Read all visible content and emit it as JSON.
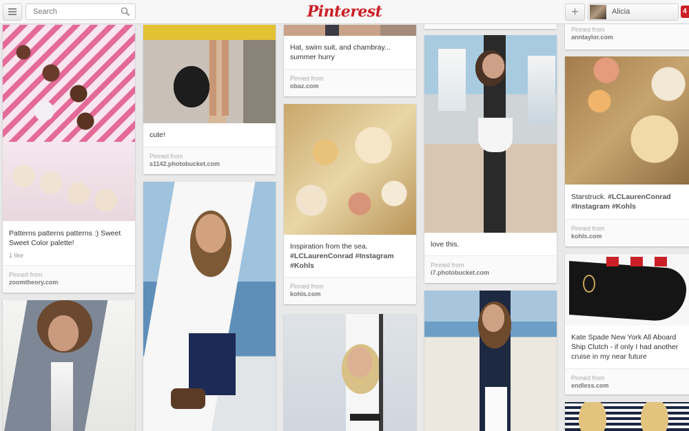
{
  "header": {
    "search_placeholder": "Search",
    "logo_text": "Pinterest",
    "add_label": "+",
    "user_name": "Alicia",
    "notification_count": "4"
  },
  "pins": {
    "patterns": {
      "description": "Patterns patterns patterns :) Sweet Sweet Color palette!",
      "likes": "1 like",
      "pinned_from": "Pinned from",
      "source": "zoomtheory.com"
    },
    "cute": {
      "description": "cute!",
      "pinned_from": "Pinned from",
      "source": "s1142.photobucket.com"
    },
    "hat": {
      "description": "Hat, swim suit, and chambray... summer hurry",
      "pinned_from": "Pinned from",
      "source": "obaz.com"
    },
    "sea": {
      "description_main": "Inspiration from the sea.",
      "description_tags": "#LCLaurenConrad #Instagram #Kohls",
      "pinned_from": "Pinned from",
      "source": "kohls.com"
    },
    "lovethis": {
      "description": "love this.",
      "pinned_from": "Pinned from",
      "source": "i7.photobucket.com"
    },
    "ann": {
      "pinned_from": "Pinned from",
      "source": "anntaylor.com"
    },
    "starstruck": {
      "description_main": "Starstruck.",
      "description_tags": "#LCLaurenConrad #Instagram #Kohls",
      "pinned_from": "Pinned from",
      "source": "kohls.com"
    },
    "clutch": {
      "description": "Kate Spade New York All Aboard Ship Clutch - if only I had another cruise in my near future",
      "pinned_from": "Pinned from",
      "source": "endless.com"
    }
  },
  "colors": {
    "brand": "#cb2027",
    "background": "#e9e9e9"
  },
  "icons": [
    "menu-icon",
    "search-icon",
    "add-icon"
  ]
}
